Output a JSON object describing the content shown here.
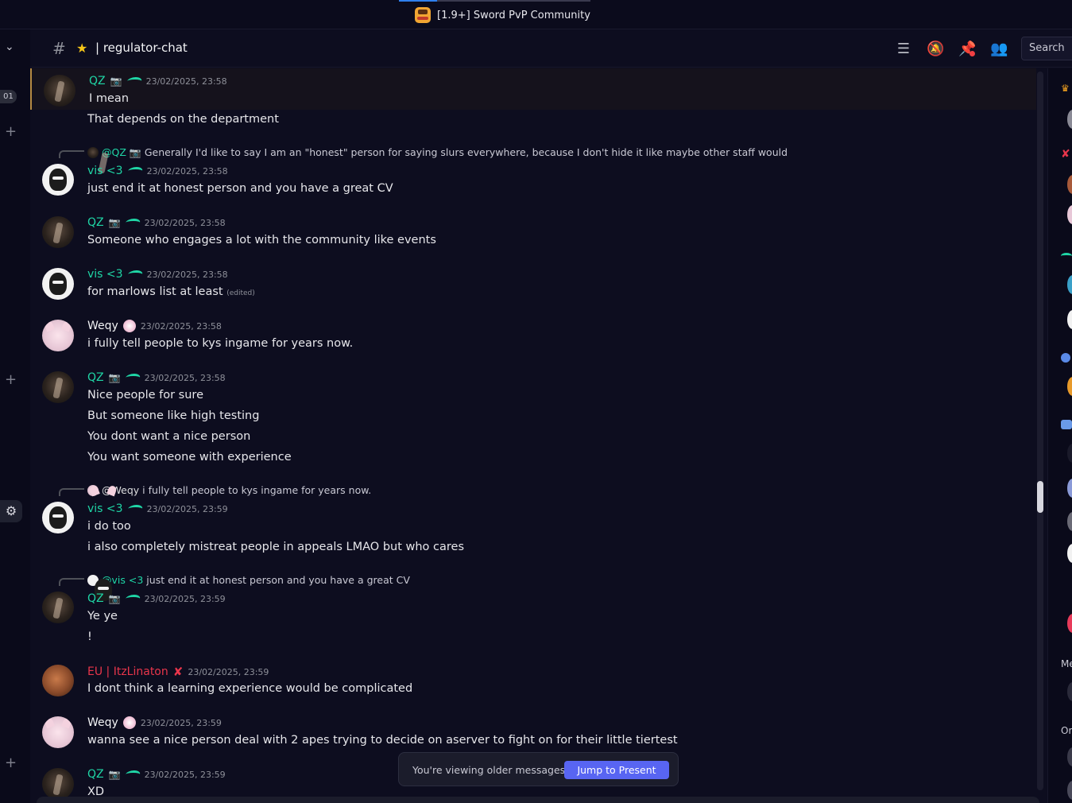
{
  "window": {
    "title": "[1.9+] Sword PvP Community"
  },
  "rail": {
    "badge": "01"
  },
  "header": {
    "channel_name": "| regulator-chat",
    "search_placeholder": "Search"
  },
  "messages": [
    {
      "author": "QZ",
      "timestamp": "23/02/2025, 23:58",
      "lines": [
        "I mean",
        "That depends on the department"
      ]
    },
    {
      "reply": {
        "mention": "@QZ",
        "text": "Generally I'd like to say I am an \"honest\" person for saying slurs everywhere, because I don't hide it like maybe other staff would"
      },
      "author": "vis <3",
      "timestamp": "23/02/2025, 23:58",
      "lines": [
        "just end it at honest person and you have a great CV"
      ]
    },
    {
      "author": "QZ",
      "timestamp": "23/02/2025, 23:58",
      "lines": [
        "Someone who engages a lot with the community like events"
      ]
    },
    {
      "author": "vis <3",
      "timestamp": "23/02/2025, 23:58",
      "lines": [
        "for marlows list at least"
      ],
      "edited": "(edited)"
    },
    {
      "author": "Weqy",
      "timestamp": "23/02/2025, 23:58",
      "lines": [
        "i fully tell people to kys ingame for years now."
      ]
    },
    {
      "author": "QZ",
      "timestamp": "23/02/2025, 23:58",
      "lines": [
        "Nice people for sure",
        "But someone like high testing",
        "You dont want a nice person",
        "You want someone with experience"
      ]
    },
    {
      "reply": {
        "mention": "@Weqy",
        "text": "i fully tell people to kys ingame for years now."
      },
      "author": "vis <3",
      "timestamp": "23/02/2025, 23:59",
      "lines": [
        "i do too",
        "i also completely mistreat people in appeals LMAO but who cares"
      ]
    },
    {
      "reply": {
        "mention": "@vis <3",
        "text": "just end it at honest person and you have a great CV"
      },
      "author": "QZ",
      "timestamp": "23/02/2025, 23:59",
      "lines": [
        "Ye ye",
        "!"
      ]
    },
    {
      "author": "EU | ItzLinaton",
      "timestamp": "23/02/2025, 23:59",
      "lines": [
        "I dont think a learning experience would be complicated"
      ]
    },
    {
      "author": "Weqy",
      "timestamp": "23/02/2025, 23:59",
      "lines": [
        "wanna see a nice person deal with 2 apes trying to decide on aserver to fight on for their little tiertest"
      ]
    },
    {
      "author": "QZ",
      "timestamp": "23/02/2025, 23:59",
      "lines": [
        "XD"
      ]
    }
  ],
  "banner": {
    "text": "You're viewing older messages",
    "button": "Jump to Present"
  },
  "members": {
    "section_me": "Me",
    "section_or": "Or"
  },
  "colors": {
    "accent": "#5865f2",
    "teal_role": "#1fd6a6",
    "red_role": "#e8354b"
  }
}
